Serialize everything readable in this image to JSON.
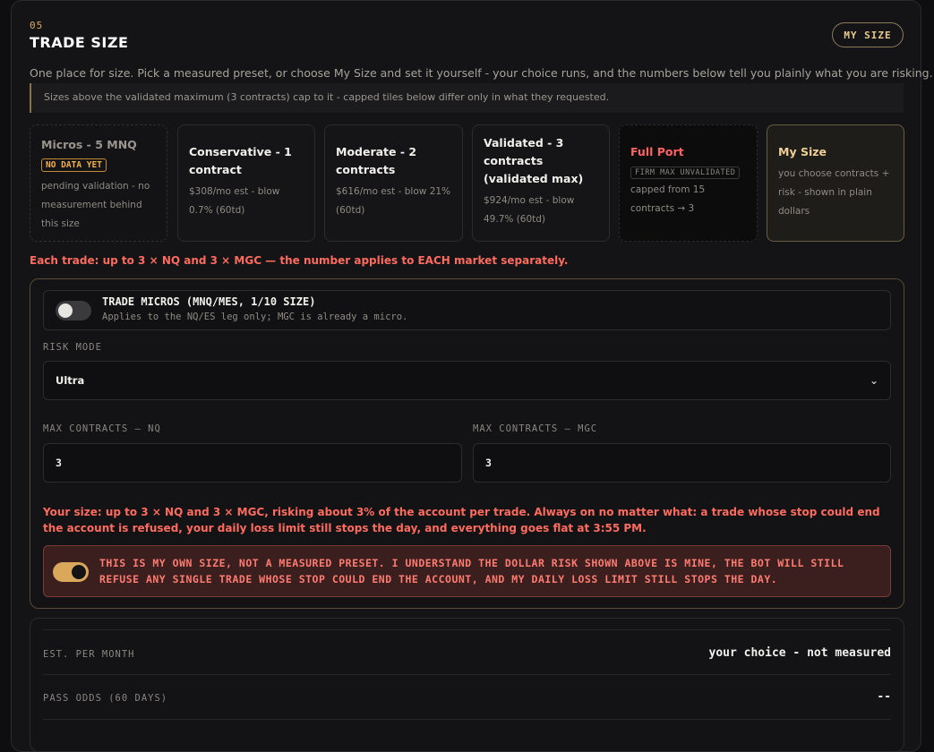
{
  "section": {
    "number": "05",
    "title": "TRADE SIZE",
    "my_size_button": "MY SIZE",
    "description": "One place for size. Pick a measured preset, or choose My Size and set it yourself - your choice runs, and the numbers below tell you plainly what you are risking.",
    "cap_note": "Sizes above the validated maximum (3 contracts) cap to it - capped tiles below differ only in what they requested."
  },
  "tiles": [
    {
      "name": "Micros - 5 MNQ",
      "badge": "NO DATA YET",
      "sub": "pending validation - no measurement behind this size"
    },
    {
      "name": "Conservative - 1 contract",
      "sub": "$308/mo est - blow 0.7% (60td)"
    },
    {
      "name": "Moderate - 2 contracts",
      "sub": "$616/mo est - blow 21% (60td)"
    },
    {
      "name": "Validated - 3 contracts (validated max)",
      "sub": "$924/mo est - blow 49.7% (60td)"
    },
    {
      "name": "Full Port",
      "badge": "FIRM MAX UNVALIDATED",
      "sub": "capped from 15 contracts → 3"
    },
    {
      "name": "My Size",
      "sub": "you choose contracts + risk - shown in plain dollars"
    }
  ],
  "per_market_warning": "Each trade: up to 3 × NQ and 3 × MGC — the number applies to EACH market separately.",
  "micros": {
    "title": "TRADE MICROS (MNQ/MES, 1/10 SIZE)",
    "subtitle": "Applies to the NQ/ES leg only; MGC is already a micro.",
    "enabled": false
  },
  "risk_mode": {
    "label": "RISK MODE",
    "value": "Ultra"
  },
  "max_nq": {
    "label": "MAX CONTRACTS — NQ",
    "value": "3"
  },
  "max_mgc": {
    "label": "MAX CONTRACTS — MGC",
    "value": "3"
  },
  "risk_summary": "Your size: up to 3 × NQ and 3 × MGC, risking about 3% of the account per trade. Always on no matter what: a trade whose stop could end the account is refused, your daily loss limit still stops the day, and everything goes flat at 3:55 PM.",
  "acknowledgement": {
    "text": "THIS IS MY OWN SIZE, NOT A MEASURED PRESET. I UNDERSTAND THE DOLLAR RISK SHOWN ABOVE IS MINE, THE BOT WILL STILL REFUSE ANY SINGLE TRADE WHOSE STOP COULD END THE ACCOUNT, AND MY DAILY LOSS LIMIT STILL STOPS THE DAY.",
    "enabled": true
  },
  "stats": [
    {
      "label": "EST. PER MONTH",
      "value": "your choice - not measured"
    },
    {
      "label": "PASS ODDS (60 DAYS)",
      "value": "--"
    }
  ],
  "colors": {
    "accent": "#d9a85b",
    "warning": "#ff6b5e",
    "background": "#141416"
  }
}
